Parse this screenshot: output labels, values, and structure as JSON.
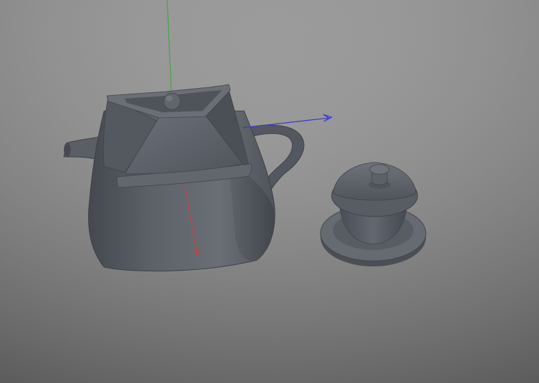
{
  "viewport": {
    "background_top": "#a3a3a3",
    "background_bottom": "#6f6f6f"
  },
  "axes": {
    "y_color": "#3fa83f",
    "z_color": "#3a3ac8",
    "x_color": "#c84040"
  },
  "objects": [
    {
      "name": "teapot",
      "color": "#5b6068"
    },
    {
      "name": "gaiwan-cup-with-saucer",
      "color": "#5b6068"
    }
  ]
}
